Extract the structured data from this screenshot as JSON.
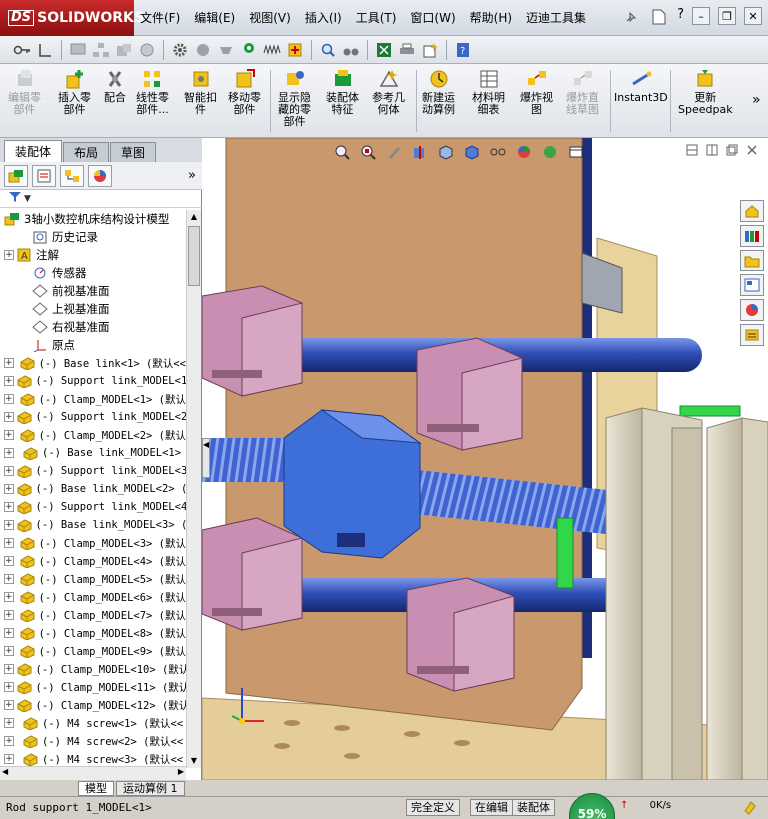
{
  "app": {
    "logo_text": "SOLIDWORKS",
    "logo_mark": "DS"
  },
  "menu": [
    "文件(F)",
    "编辑(E)",
    "视图(V)",
    "插入(I)",
    "工具(T)",
    "窗口(W)",
    "帮助(H)",
    "迈迪工具集"
  ],
  "title_right": {
    "help_glyph": "?",
    "min": "–",
    "restore": "❐",
    "close": "✕"
  },
  "commands": [
    {
      "label": "编辑零\n部件",
      "disabled": true
    },
    {
      "label": "插入零\n部件",
      "disabled": false
    },
    {
      "label": "配合",
      "disabled": false
    },
    {
      "label": "线性零\n部件...",
      "disabled": false
    },
    {
      "label": "智能扣\n件",
      "disabled": false
    },
    {
      "label": "移动零\n部件",
      "disabled": false
    },
    {
      "label": "显示隐\n藏的零\n部件",
      "disabled": false
    },
    {
      "label": "装配体\n特征",
      "disabled": false
    },
    {
      "label": "参考几\n何体",
      "disabled": false
    },
    {
      "label": "新建运\n动算例",
      "disabled": false
    },
    {
      "label": "材料明\n细表",
      "disabled": false
    },
    {
      "label": "爆炸视\n图",
      "disabled": false
    },
    {
      "label": "爆炸直\n线草图",
      "disabled": true
    },
    {
      "label": "Instant3D",
      "disabled": false
    },
    {
      "label": "更新\nSpeedpak",
      "disabled": false
    }
  ],
  "more_glyph": "»",
  "panel_tabs": [
    "装配体",
    "布局",
    "草图"
  ],
  "tree": {
    "root": "3轴小数控机床结构设计模型",
    "fixed": [
      "历史记录",
      "注解",
      "传感器",
      "前视基准面",
      "上视基准面",
      "右视基准面",
      "原点"
    ],
    "parts": [
      "(-) Base link<1> (默认<<",
      "(-) Support link_MODEL<1",
      "(-) Clamp_MODEL<1> (默认",
      "(-) Support link_MODEL<2",
      "(-) Clamp_MODEL<2> (默认",
      "(-) Base link_MODEL<1>",
      "(-) Support link_MODEL<3",
      "(-) Base link_MODEL<2> (",
      "(-) Support link_MODEL<4",
      "(-) Base link_MODEL<3> (",
      "(-) Clamp_MODEL<3> (默认",
      "(-) Clamp_MODEL<4> (默认",
      "(-) Clamp_MODEL<5> (默认",
      "(-) Clamp_MODEL<6> (默认",
      "(-) Clamp_MODEL<7> (默认",
      "(-) Clamp_MODEL<8> (默认",
      "(-) Clamp_MODEL<9> (默认",
      "(-) Clamp_MODEL<10> (默认",
      "(-) Clamp_MODEL<11> (默认",
      "(-) Clamp_MODEL<12> (默认",
      "(-) M4 screw<1> (默认<<",
      "(-) M4 screw<2> (默认<<",
      "(-) M4 screw<3> (默认<<"
    ]
  },
  "bottom_tabs": [
    "模型",
    "运动算例 1"
  ],
  "status": {
    "selection": "Rod support 1_MODEL<1>",
    "definition": "完全定义",
    "editing": "在编辑",
    "mode": "装配体",
    "gauge": "59%",
    "speed": "0K/s"
  },
  "colors": {
    "panel_bg": "#d4d0c8",
    "plate": "#c99a6e",
    "block": "#c98fb2",
    "nut": "#3e6fd8",
    "rod": "#2f4fb8",
    "rail": "#dcd5c2",
    "base": "#e7cf9b",
    "green": "#31d64b"
  }
}
